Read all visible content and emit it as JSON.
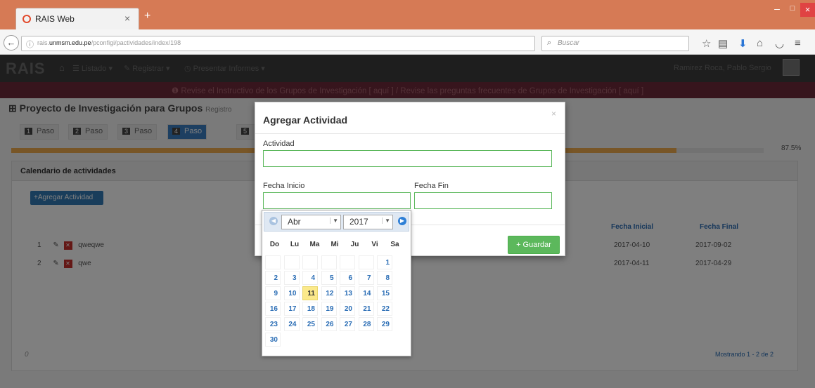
{
  "browser": {
    "tab_title": "RAIS Web",
    "tab_close": "×",
    "new_tab": "+",
    "url_host": "rais.unmsm.edu.pe",
    "url_path": "/pconfigi/pactividades/index/198",
    "url_prefix": "rais.",
    "url_domain": "unmsm.edu.pe",
    "search_placeholder": "Buscar",
    "window_min": "–",
    "window_max": "□",
    "window_close": "×"
  },
  "app": {
    "logo": "RAIS",
    "menu": [
      "Listado",
      "Registrar",
      "Presentar Informes"
    ],
    "user_name": "Ramirez Roca, Pablo Sergio",
    "alert": "Revise el Instructivo de los Grupos de Investigación [ aquí ] / Revise las preguntas frecuentes de Grupos de Investigación [ aquí ]"
  },
  "page": {
    "title": "Proyecto de Investigación para Grupos",
    "title_sub": "Registro",
    "steps": [
      {
        "num": "1",
        "label": "Paso"
      },
      {
        "num": "2",
        "label": "Paso"
      },
      {
        "num": "3",
        "label": "Paso"
      },
      {
        "num": "4",
        "label": "Paso"
      },
      {
        "num": "5",
        "label": ""
      }
    ],
    "progress_label": "87.5%",
    "progress_value": 0.875,
    "panel_title": "Calendario de actividades",
    "add_button": "+Agregar Actividad",
    "table_headers": {
      "fecha_inicial": "Fecha Inicial",
      "fecha_final": "Fecha Final"
    },
    "rows": [
      {
        "num": "1",
        "actividad": "qweqwe",
        "inicio": "2017-04-10",
        "fin": "2017-09-02"
      },
      {
        "num": "2",
        "actividad": "qwe",
        "inicio": "2017-04-11",
        "fin": "2017-04-29"
      }
    ],
    "footer_left": "0",
    "footer_right": "Mostrando 1 - 2 de 2"
  },
  "modal": {
    "title": "Agregar Actividad",
    "close": "×",
    "label_actividad": "Actividad",
    "label_fecha_inicio": "Fecha Inicio",
    "label_fecha_fin": "Fecha Fin",
    "save_button": "+ Guardar"
  },
  "datepicker": {
    "month": "Abr",
    "year": "2017",
    "weekdays": [
      "Do",
      "Lu",
      "Ma",
      "Mi",
      "Ju",
      "Vi",
      "Sa"
    ],
    "today": 11,
    "days": [
      1,
      2,
      3,
      4,
      5,
      6,
      7,
      8,
      9,
      10,
      11,
      12,
      13,
      14,
      15,
      16,
      17,
      18,
      19,
      20,
      21,
      22,
      23,
      24,
      25,
      26,
      27,
      28,
      29,
      30
    ],
    "first_weekday_index": 6
  }
}
